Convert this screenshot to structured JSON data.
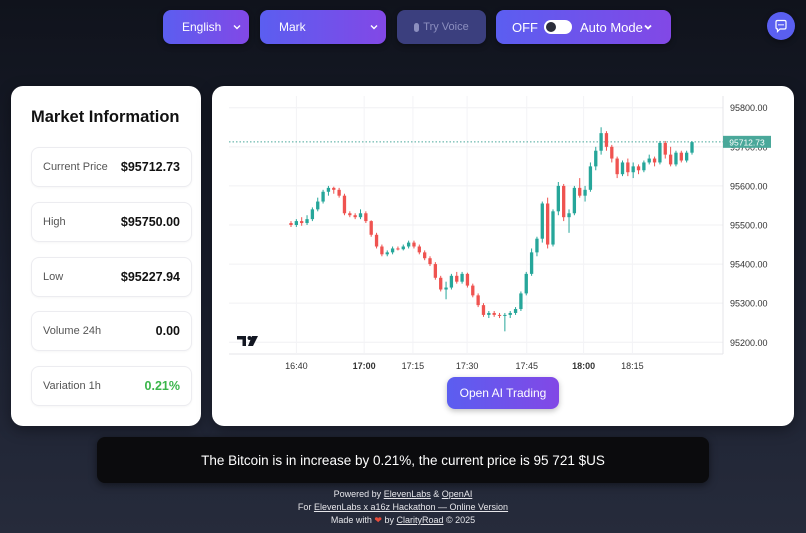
{
  "controls": {
    "language": "English",
    "voice": "Mark",
    "try_voice": "Try Voice",
    "auto_mode_state": "OFF",
    "auto_mode_label": "Auto Mode"
  },
  "market": {
    "title": "Market Information",
    "stats": [
      {
        "label": "Current Price",
        "value": "$95712.73"
      },
      {
        "label": "High",
        "value": "$95750.00"
      },
      {
        "label": "Low",
        "value": "$95227.94"
      },
      {
        "label": "Volume 24h",
        "value": "0.00"
      },
      {
        "label": "Variation 1h",
        "value": "0.21%"
      }
    ]
  },
  "colors": {
    "up": "#26a69a",
    "down": "#ef5350",
    "positive_text": "#3ab54a",
    "accent_start": "#5b5ef0",
    "accent_end": "#8248e6",
    "price_tag": "#4aa89a"
  },
  "chart_data": {
    "type": "candlestick",
    "current_price": 95712.73,
    "current_price_label": "95712.73",
    "y_ticks": [
      "95800.00",
      "95700.00",
      "95600.00",
      "95500.00",
      "95400.00",
      "95300.00",
      "95200.00"
    ],
    "x_ticks": [
      "16:40",
      "17:00",
      "17:15",
      "17:30",
      "17:45",
      "18:00",
      "18:15"
    ],
    "bold_x_ticks": [
      "17:00",
      "18:00"
    ],
    "ylim": [
      95170,
      95830
    ],
    "candles": [
      [
        95505,
        95510,
        95495,
        95500
      ],
      [
        95500,
        95515,
        95495,
        95510
      ],
      [
        95510,
        95520,
        95498,
        95505
      ],
      [
        95505,
        95525,
        95500,
        95515
      ],
      [
        95515,
        95545,
        95510,
        95540
      ],
      [
        95540,
        95570,
        95535,
        95560
      ],
      [
        95560,
        95590,
        95555,
        95585
      ],
      [
        95585,
        95600,
        95575,
        95595
      ],
      [
        95595,
        95598,
        95580,
        95590
      ],
      [
        95590,
        95595,
        95570,
        95575
      ],
      [
        95575,
        95580,
        95525,
        95530
      ],
      [
        95530,
        95535,
        95520,
        95525
      ],
      [
        95525,
        95530,
        95515,
        95520
      ],
      [
        95520,
        95540,
        95515,
        95530
      ],
      [
        95530,
        95535,
        95505,
        95510
      ],
      [
        95510,
        95512,
        95470,
        95475
      ],
      [
        95475,
        95480,
        95440,
        95445
      ],
      [
        95445,
        95450,
        95420,
        95425
      ],
      [
        95425,
        95435,
        95420,
        95430
      ],
      [
        95430,
        95445,
        95425,
        95440
      ],
      [
        95440,
        95445,
        95435,
        95438
      ],
      [
        95438,
        95450,
        95435,
        95445
      ],
      [
        95445,
        95460,
        95440,
        95455
      ],
      [
        95455,
        95460,
        95440,
        95445
      ],
      [
        95445,
        95450,
        95425,
        95430
      ],
      [
        95430,
        95435,
        95410,
        95415
      ],
      [
        95415,
        95420,
        95395,
        95400
      ],
      [
        95400,
        95405,
        95360,
        95365
      ],
      [
        95365,
        95370,
        95330,
        95335
      ],
      [
        95335,
        95355,
        95310,
        95340
      ],
      [
        95340,
        95375,
        95335,
        95370
      ],
      [
        95370,
        95380,
        95350,
        95355
      ],
      [
        95355,
        95380,
        95350,
        95375
      ],
      [
        95375,
        95378,
        95340,
        95345
      ],
      [
        95345,
        95350,
        95315,
        95320
      ],
      [
        95320,
        95325,
        95290,
        95295
      ],
      [
        95295,
        95300,
        95265,
        95270
      ],
      [
        95270,
        95280,
        95262,
        95275
      ],
      [
        95275,
        95280,
        95265,
        95270
      ],
      [
        95270,
        95275,
        95262,
        95268
      ],
      [
        95268,
        95275,
        95228,
        95270
      ],
      [
        95270,
        95280,
        95262,
        95275
      ],
      [
        95275,
        95290,
        95270,
        95285
      ],
      [
        95285,
        95330,
        95280,
        95325
      ],
      [
        95325,
        95380,
        95320,
        95375
      ],
      [
        95375,
        95440,
        95370,
        95430
      ],
      [
        95430,
        95470,
        95420,
        95465
      ],
      [
        95465,
        95560,
        95455,
        95555
      ],
      [
        95555,
        95570,
        95440,
        95450
      ],
      [
        95450,
        95540,
        95445,
        95535
      ],
      [
        95535,
        95610,
        95525,
        95600
      ],
      [
        95600,
        95605,
        95510,
        95520
      ],
      [
        95520,
        95540,
        95480,
        95530
      ],
      [
        95530,
        95600,
        95525,
        95595
      ],
      [
        95595,
        95620,
        95570,
        95575
      ],
      [
        95575,
        95600,
        95560,
        95590
      ],
      [
        95590,
        95660,
        95585,
        95650
      ],
      [
        95650,
        95700,
        95640,
        95690
      ],
      [
        95690,
        95750,
        95680,
        95735
      ],
      [
        95735,
        95740,
        95690,
        95700
      ],
      [
        95700,
        95705,
        95660,
        95670
      ],
      [
        95670,
        95675,
        95620,
        95630
      ],
      [
        95630,
        95665,
        95625,
        95660
      ],
      [
        95660,
        95670,
        95625,
        95635
      ],
      [
        95635,
        95660,
        95620,
        95650
      ],
      [
        95650,
        95655,
        95630,
        95640
      ],
      [
        95640,
        95665,
        95635,
        95660
      ],
      [
        95660,
        95680,
        95655,
        95670
      ],
      [
        95670,
        95675,
        95650,
        95660
      ],
      [
        95660,
        95715,
        95655,
        95710
      ],
      [
        95710,
        95715,
        95670,
        95680
      ],
      [
        95680,
        95700,
        95650,
        95655
      ],
      [
        95655,
        95690,
        95650,
        95685
      ],
      [
        95685,
        95690,
        95660,
        95665
      ],
      [
        95665,
        95690,
        95660,
        95685
      ],
      [
        95685,
        95715,
        95680,
        95712
      ]
    ]
  },
  "trade_button": "Open AI Trading",
  "message": "The Bitcoin is in increase by 0.21%, the current price is 95 721 $US",
  "footer": {
    "powered_by": "Powered by",
    "elevenlabs": "ElevenLabs",
    "amp": "&",
    "openai": "OpenAI",
    "for_text": "For",
    "hackathon": "ElevenLabs x a16z Hackathon — Online Version",
    "made_with": "Made with",
    "by": "by",
    "clarityroad": "ClarityRoad",
    "year": "© 2025"
  }
}
